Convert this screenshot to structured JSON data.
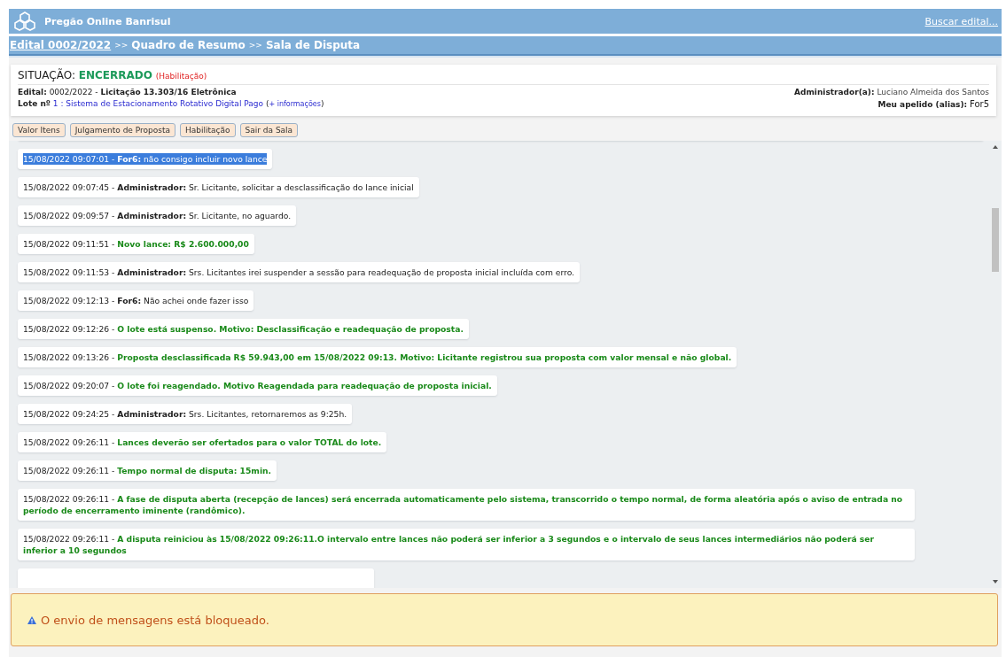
{
  "header": {
    "title": "Pregão Online Banrisul",
    "search_link": "Buscar edital..."
  },
  "breadcrumb": [
    {
      "label": "Edital 0002/2022",
      "link": true
    },
    {
      "label": "Quadro de Resumo",
      "link": false
    },
    {
      "label": "Sala de Disputa",
      "link": false
    }
  ],
  "breadcrumb_separator": ">>",
  "info": {
    "situacao_label": "SITUAÇÃO:",
    "situacao_value": "ENCERRADO",
    "situacao_phase": "(Habilitação)",
    "edital_label": "Edital:",
    "edital_value": "0002/2022",
    "edital_sep": "-",
    "licitacao": "Licitação 13.303/16 Eletrônica",
    "lote_label": "Lote nº",
    "lote_number": "1",
    "lote_colon": ":",
    "lote_name": "Sistema de Estacionamento Rotativo Digital Pago",
    "lote_more_open": "(",
    "lote_more": "+ informações",
    "lote_more_close": ")",
    "admin_label": "Administrador(a):",
    "admin_value": "Luciano Almeida dos Santos",
    "alias_label": "Meu apelido (alias):",
    "alias_value": "For5"
  },
  "buttons": [
    "Valor Itens",
    "Julgamento de Proposta",
    "Habilitação",
    "Sair da Sala"
  ],
  "messages": [
    {
      "kind": "chat",
      "time": "15/08/2022 09:07:01",
      "author": "For6:",
      "text": "não consigo incluir novo lance",
      "selected": true
    },
    {
      "kind": "chat",
      "time": "15/08/2022 09:07:45",
      "author": "Administrador:",
      "text": "Sr. Licitante, solicitar a desclassificação do lance inicial",
      "selected": false
    },
    {
      "kind": "chat",
      "time": "15/08/2022 09:09:57",
      "author": "Administrador:",
      "text": "Sr. Licitante, no aguardo.",
      "selected": false
    },
    {
      "kind": "system",
      "time": "15/08/2022 09:11:51",
      "text": "Novo lance: R$ 2.600.000,00",
      "selected": false
    },
    {
      "kind": "chat",
      "time": "15/08/2022 09:11:53",
      "author": "Administrador:",
      "text": "Srs. Licitantes irei suspender a sessão para readequação de proposta inicial incluída com erro.",
      "selected": false
    },
    {
      "kind": "chat",
      "time": "15/08/2022 09:12:13",
      "author": "For6:",
      "text": "Não achei onde fazer isso",
      "selected": false
    },
    {
      "kind": "system",
      "time": "15/08/2022 09:12:26",
      "text": "O lote está suspenso. Motivo: Desclassificação e readequação de proposta.",
      "selected": false
    },
    {
      "kind": "system",
      "time": "15/08/2022 09:13:26",
      "text": "Proposta desclassificada R$ 59.943,00 em 15/08/2022 09:13. Motivo: Licitante registrou sua proposta com valor mensal e não global.",
      "selected": false
    },
    {
      "kind": "system",
      "time": "15/08/2022 09:20:07",
      "text": "O lote foi reagendado. Motivo Reagendada para readequação de proposta inicial.",
      "selected": false
    },
    {
      "kind": "chat",
      "time": "15/08/2022 09:24:25",
      "author": "Administrador:",
      "text": "Srs. Licitantes, retornaremos as 9:25h.",
      "selected": false
    },
    {
      "kind": "system",
      "time": "15/08/2022 09:26:11",
      "text": "Lances deverão ser ofertados para o valor TOTAL do lote.",
      "selected": false
    },
    {
      "kind": "system",
      "time": "15/08/2022 09:26:11",
      "text": "Tempo normal de disputa: 15min.",
      "selected": false
    },
    {
      "kind": "system",
      "time": "15/08/2022 09:26:11",
      "text": "A fase de disputa aberta (recepção de lances) será encerrada automaticamente pelo sistema, transcorrido o tempo normal, de forma aleatória após o aviso de entrada no período de encerramento iminente (randômico).",
      "selected": false
    },
    {
      "kind": "system",
      "time": "15/08/2022 09:26:11",
      "text": "A disputa reiniciou às 15/08/2022 09:26:11.O intervalo entre lances não poderá ser inferior a 3 segundos e o intervalo de seus lances intermediários não poderá ser inferior a 10 segundos",
      "selected": false
    }
  ],
  "message_separator": "-",
  "alert": {
    "text": "O envio de mensagens está bloqueado."
  }
}
